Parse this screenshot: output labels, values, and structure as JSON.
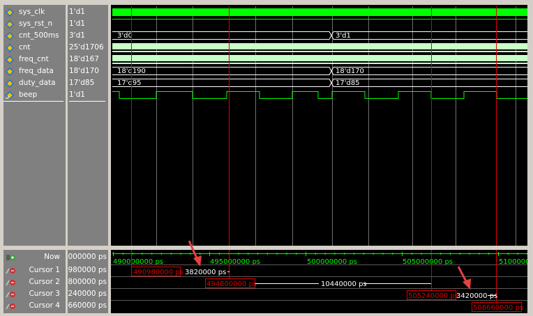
{
  "signals": [
    {
      "name": "sys_clk",
      "value": "1'd1"
    },
    {
      "name": "sys_rst_n",
      "value": "1'd1"
    },
    {
      "name": "cnt_500ms",
      "value": "3'd1"
    },
    {
      "name": "cnt",
      "value": "25'd1706"
    },
    {
      "name": "freq_cnt",
      "value": "18'd167"
    },
    {
      "name": "freq_data",
      "value": "18'd170"
    },
    {
      "name": "duty_data",
      "value": "17'd85"
    },
    {
      "name": "beep",
      "value": "1'd1"
    }
  ],
  "bus_labels": {
    "cnt_500ms_a": "3'd0",
    "cnt_500ms_b": "3'd1",
    "freq_data_a": "18'd190",
    "freq_data_b": "18'd170",
    "duty_data_a": "17'd95",
    "duty_data_b": "17'd85"
  },
  "now": {
    "label": "Now",
    "value": "000000 ps"
  },
  "cursors": [
    {
      "label": "Cursor 1",
      "value": "980000 ps",
      "time": "490980000 ps"
    },
    {
      "label": "Cursor 2",
      "value": "800000 ps",
      "time": "494800000 ps"
    },
    {
      "label": "Cursor 3",
      "value": "240000 ps",
      "time": "505240000 ps"
    },
    {
      "label": "Cursor 4",
      "value": "660000 ps",
      "time": "508660000 ps"
    }
  ],
  "deltas": {
    "d12": "3820000 ps",
    "d23": "10440000 ps",
    "d34": "3420000 ps"
  },
  "timeline_ticks": [
    "490000000 ps",
    "495000000 ps",
    "500000000 ps",
    "505000000 ps",
    "5100000"
  ],
  "colors": {
    "clk": "#00ff00",
    "bus": "#c8ffc8",
    "cursor": "#e00000",
    "annot_arrow": "#e84040",
    "panel": "#808080"
  }
}
